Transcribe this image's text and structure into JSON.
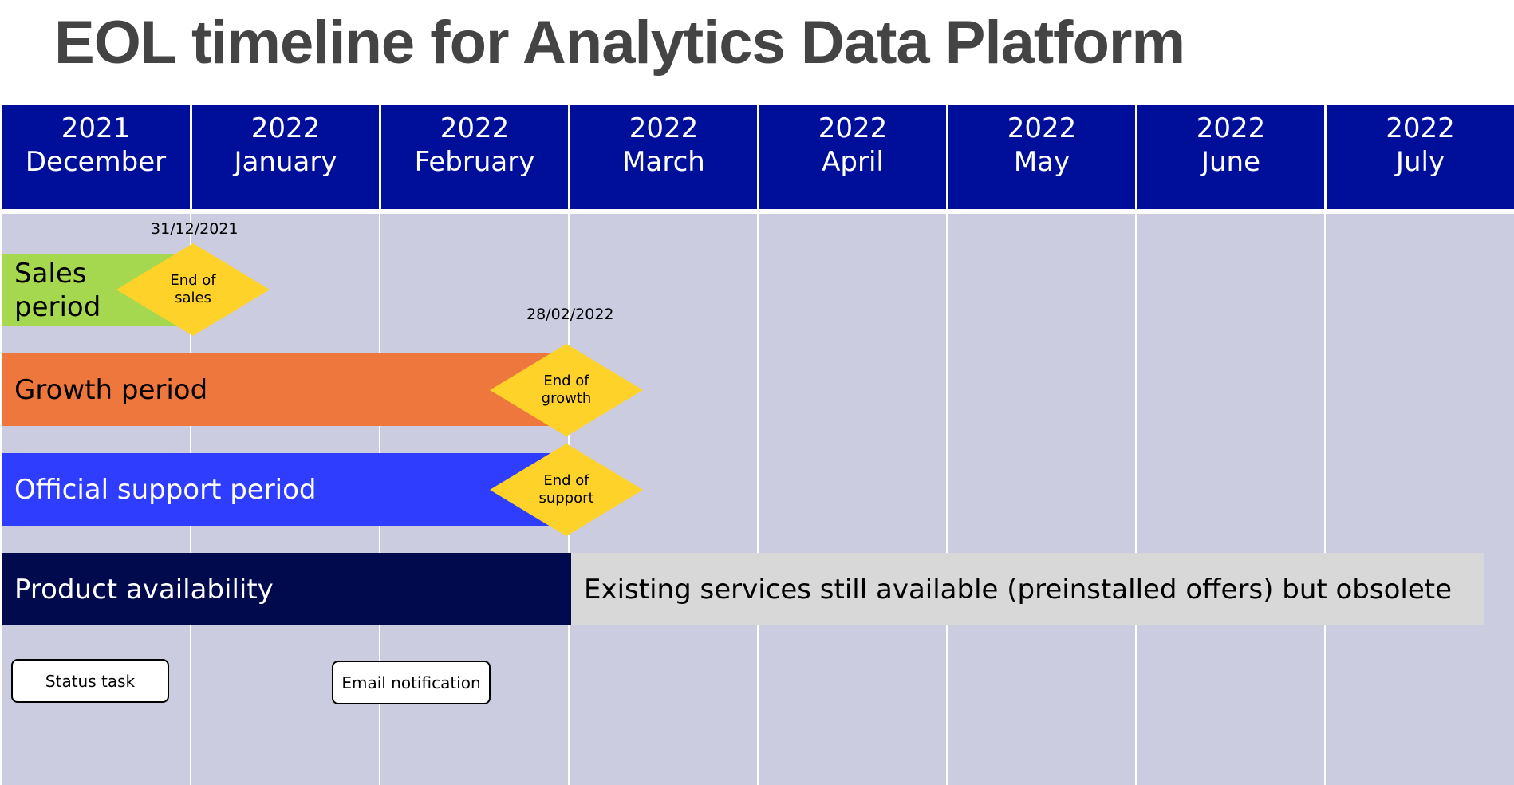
{
  "title": "EOL timeline for Analytics Data Platform",
  "months": [
    {
      "year": "2021",
      "month": "December"
    },
    {
      "year": "2022",
      "month": "January"
    },
    {
      "year": "2022",
      "month": "February"
    },
    {
      "year": "2022",
      "month": "March"
    },
    {
      "year": "2022",
      "month": "April"
    },
    {
      "year": "2022",
      "month": "May"
    },
    {
      "year": "2022",
      "month": "June"
    },
    {
      "year": "2022",
      "month": "July"
    }
  ],
  "bars": {
    "sales": {
      "label_line1": "Sales",
      "label_line2": "period",
      "color": "#a6d84f"
    },
    "growth": {
      "label": "Growth period",
      "color": "#ee773d"
    },
    "support": {
      "label": "Official support period",
      "color": "#2e3dff"
    },
    "availability": {
      "label": "Product availability",
      "color": "#000a4d"
    },
    "obsolete": {
      "label": "Existing services still available (preinstalled offers) but obsolete",
      "color": "#d8d8d8"
    }
  },
  "milestones": {
    "end_of_sales": {
      "line1": "End of",
      "line2": "sales",
      "date": "31/12/2021"
    },
    "end_of_growth": {
      "line1": "End of",
      "line2": "growth",
      "date": "28/02/2022"
    },
    "end_of_support": {
      "line1": "End of",
      "line2": "support"
    }
  },
  "milestone_color": "#ffd22a",
  "header_color": "#000f99",
  "buttons": {
    "status_task": "Status task",
    "email_notification": "Email notification"
  }
}
